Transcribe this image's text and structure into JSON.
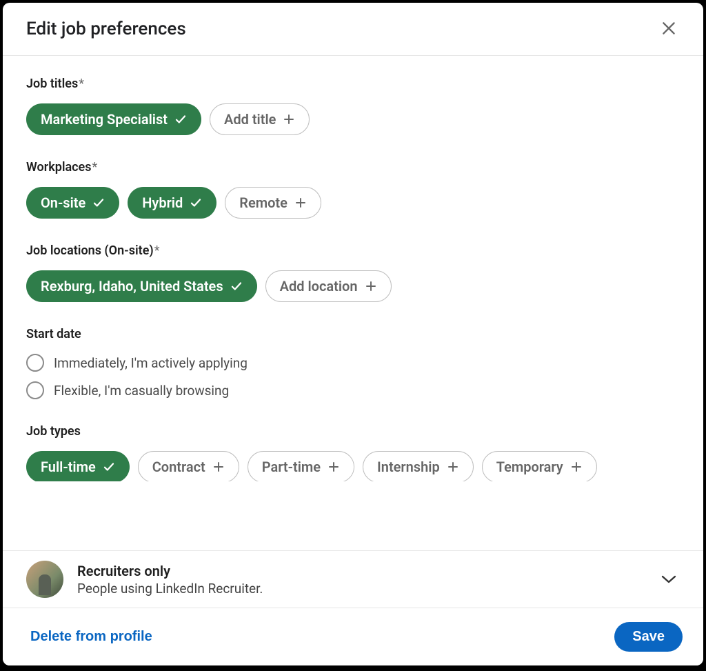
{
  "header": {
    "title": "Edit job preferences"
  },
  "sections": {
    "jobTitles": {
      "label": "Job titles",
      "required": true,
      "items": [
        {
          "label": "Marketing Specialist",
          "selected": true
        }
      ],
      "addLabel": "Add title"
    },
    "workplaces": {
      "label": "Workplaces",
      "required": true,
      "items": [
        {
          "label": "On-site",
          "selected": true
        },
        {
          "label": "Hybrid",
          "selected": true
        },
        {
          "label": "Remote",
          "selected": false
        }
      ]
    },
    "locations": {
      "label": "Job locations (On-site)",
      "required": true,
      "items": [
        {
          "label": "Rexburg, Idaho, United States",
          "selected": true
        }
      ],
      "addLabel": "Add location"
    },
    "startDate": {
      "label": "Start date",
      "options": [
        {
          "label": "Immediately, I'm actively applying"
        },
        {
          "label": "Flexible, I'm casually browsing"
        }
      ]
    },
    "jobTypes": {
      "label": "Job types",
      "items": [
        {
          "label": "Full-time",
          "selected": true
        },
        {
          "label": "Contract",
          "selected": false
        },
        {
          "label": "Part-time",
          "selected": false
        },
        {
          "label": "Internship",
          "selected": false
        },
        {
          "label": "Temporary",
          "selected": false
        }
      ]
    }
  },
  "visibility": {
    "title": "Recruiters only",
    "subtitle": "People using LinkedIn Recruiter."
  },
  "footer": {
    "deleteLabel": "Delete from profile",
    "saveLabel": "Save"
  }
}
